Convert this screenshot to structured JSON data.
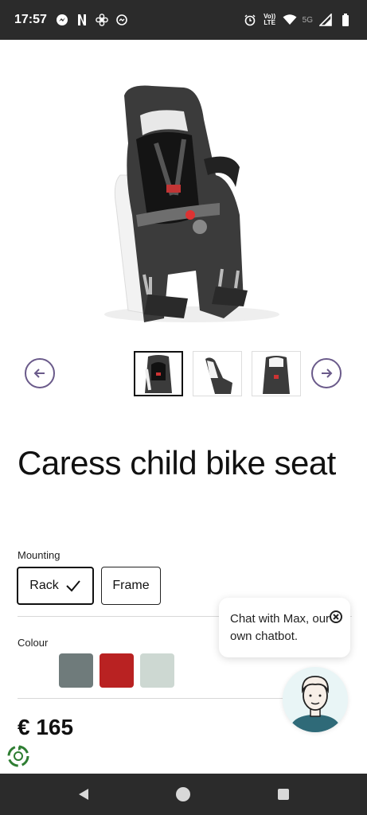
{
  "status_bar": {
    "time": "17:57",
    "left_icons": [
      "messenger-icon",
      "netflix-icon",
      "fan-icon",
      "messenger-alt-icon"
    ],
    "right_icons": [
      "alarm-icon",
      "volte-icon",
      "wifi-icon",
      "5g-icon",
      "signal-icon",
      "battery-icon"
    ],
    "volte_line1": "Vo))",
    "volte_line2": "LTE",
    "network": "5G"
  },
  "gallery": {
    "thumbnails": [
      "Seat front view",
      "Seat side view",
      "Seat rear view"
    ],
    "active_index": 0
  },
  "product": {
    "title": "Caress child bike seat",
    "price": "€ 165"
  },
  "mounting": {
    "label": "Mounting",
    "options": [
      "Rack",
      "Frame"
    ],
    "selected": "Rack"
  },
  "colour": {
    "label": "Colour",
    "swatches": [
      "#6f7b7b",
      "#b92222",
      "#cdd8d2"
    ]
  },
  "chat": {
    "message": "Chat with Max, our own chatbot."
  },
  "colors": {
    "accent": "#6a5a8a",
    "bar": "#2b2b2b"
  }
}
